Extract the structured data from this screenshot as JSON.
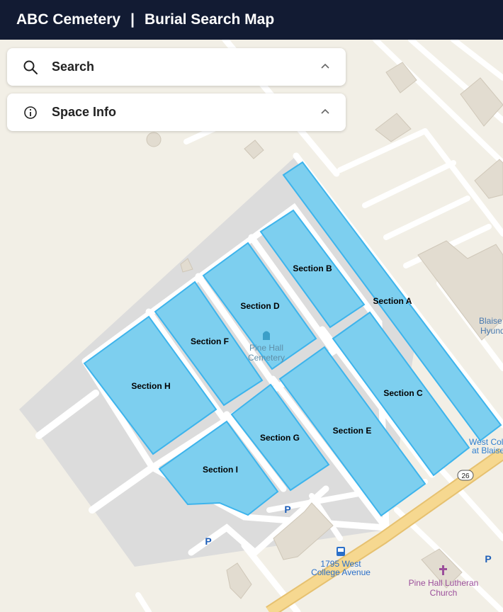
{
  "header": {
    "brand": "ABC Cemetery",
    "separator": "|",
    "title": "Burial Search Map"
  },
  "panels": {
    "search": {
      "label": "Search",
      "icon": "search-icon"
    },
    "space_info": {
      "label": "Space Info",
      "icon": "info-icon"
    }
  },
  "sections": {
    "a": "Section A",
    "b": "Section B",
    "c": "Section C",
    "d": "Section D",
    "e": "Section E",
    "f": "Section F",
    "g": "Section G",
    "h": "Section H",
    "i": "Section I"
  },
  "map_labels": {
    "cemetery_line1": "Pine Hall",
    "cemetery_line2": "Cemetery",
    "address_line1": "1795 West",
    "address_line2": "College Avenue",
    "church_line1": "Pine Hall Lutheran",
    "church_line2": "Church",
    "blaise_line1": "Blaise",
    "blaise_line2": "Hyund",
    "westcol_line1": "West Col",
    "westcol_line2": "at Blaise",
    "route": "26",
    "parking": "P"
  },
  "colors": {
    "header_bg": "#121b33",
    "section_fill": "#7dcfef",
    "section_stroke": "#3db4ec",
    "map_bg": "#f2efe6",
    "lot_gray": "#dcdcdc",
    "road_yellow": "#f6d890"
  }
}
